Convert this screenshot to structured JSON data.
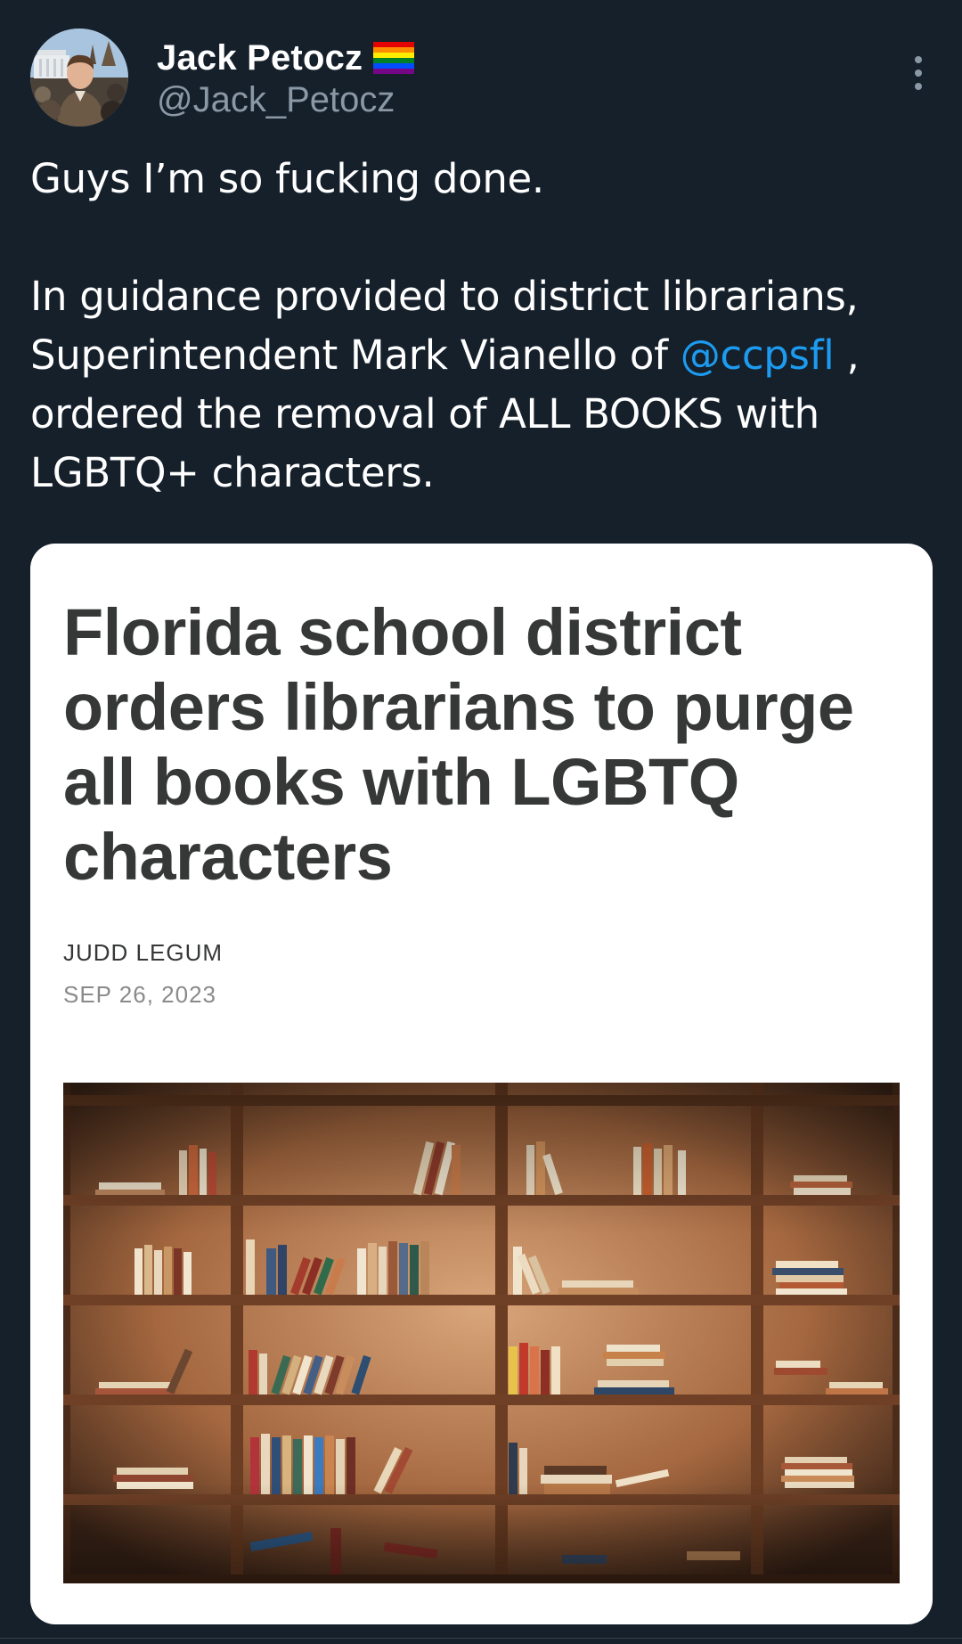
{
  "tweet": {
    "author": {
      "display_name": "Jack Petocz",
      "badge_icon": "rainbow-flag-icon",
      "handle": "@Jack_Petocz"
    },
    "text": {
      "line1": "Guys I’m so fucking done.",
      "para2_before": "In guidance provided to district librarians, Superintendent Mark Vianello of ",
      "mention": "@ccpsfl",
      "para2_after": " , ordered the removal of ALL BOOKS with LGBTQ+ characters."
    },
    "card": {
      "headline": "Florida school district orders librarians to purge all books with LGBTQ characters",
      "author": "JUDD LEGUM",
      "date": "SEP 26, 2023",
      "image_icon": "bookshelf-photo"
    },
    "menu_icon": "more-vertical-icon"
  },
  "colors": {
    "background": "#15202b",
    "text": "#ffffff",
    "secondary_text": "#8b98a5",
    "link": "#1d9bf0",
    "card_background": "#ffffff",
    "headline": "#363737"
  }
}
